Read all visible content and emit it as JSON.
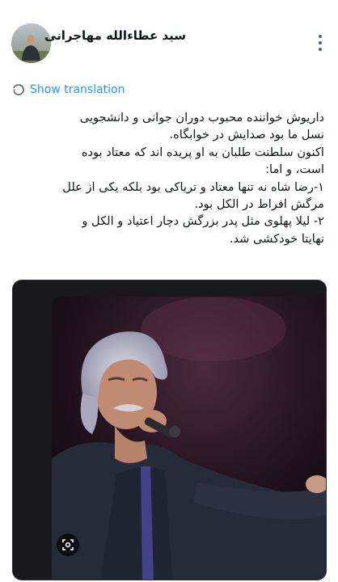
{
  "author": {
    "display_name": "سید عطاءالله مهاجرانی"
  },
  "icons": {
    "avatar": "avatar-icon",
    "more": "more-options-icon",
    "translate": "translate-icon",
    "lens": "lens-search-icon"
  },
  "colors": {
    "link": "#1d9bf0",
    "text": "#0f1419",
    "secondary": "#536471",
    "media_bg": "#17171c"
  },
  "translate": {
    "label": "Show translation"
  },
  "tweet": {
    "lines": [
      "داریوش خواننده محبوب دوران جوانی و دانشجویی",
      "نسل ما بود صدایش در خوابگاه.",
      "اکنون سلطنت طلبان به او پریده اند که معتاد بوده",
      "است، و اما:",
      "۱-رضا شاه نه تنها معتاد و تریاکی بود بلکه یکی از علل",
      "مرگش افراط در الکل بود.",
      "۲- لیلا پهلوی مثل پدر بزرگش دچار اعتیاد و الکل و",
      "نهایتا خودکشی شد."
    ]
  },
  "media": {
    "description": "singer-photo"
  }
}
